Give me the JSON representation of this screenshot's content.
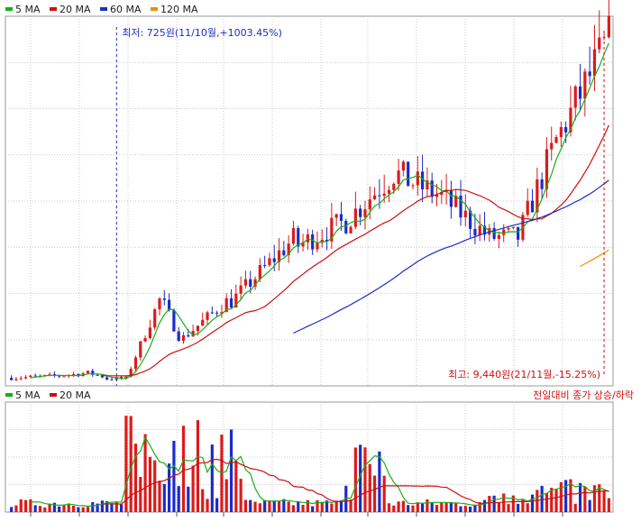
{
  "colors": {
    "up": "#dd1a1a",
    "down": "#1b2bc8",
    "ma5": "#16b016",
    "ma20": "#cc1111",
    "ma60": "#1a2fc0",
    "ma120": "#f08c00",
    "grid": "#c8c8c8",
    "annotation_low": "#1a2fc0",
    "annotation_high": "#cc1111"
  },
  "price_legend": [
    {
      "label": "5 MA",
      "color_key": "ma5"
    },
    {
      "label": "20 MA",
      "color_key": "ma20"
    },
    {
      "label": "60 MA",
      "color_key": "ma60"
    },
    {
      "label": "120 MA",
      "color_key": "ma120"
    }
  ],
  "volume_legend": [
    {
      "label": "5 MA",
      "color_key": "ma5"
    },
    {
      "label": "20 MA",
      "color_key": "ma20"
    }
  ],
  "volume_note": "전일대비 종가 상승/하락",
  "annotations": {
    "low_text": "최저: 725원(11/10월,+1003.45%)",
    "high_text": "최고: 9,440원(21/11월,-15.25%)"
  },
  "chart_data": {
    "type": "candlestick",
    "price_panel": {
      "ylim": [
        600,
        9800
      ],
      "grid": true
    },
    "volume_panel": {
      "ylim": [
        0,
        100
      ],
      "grid": true
    },
    "series_lengths": {
      "candles": 126
    },
    "low": {
      "value": 725,
      "index": 22
    },
    "high": {
      "value": 9440,
      "index": 124
    },
    "seed": 7
  }
}
